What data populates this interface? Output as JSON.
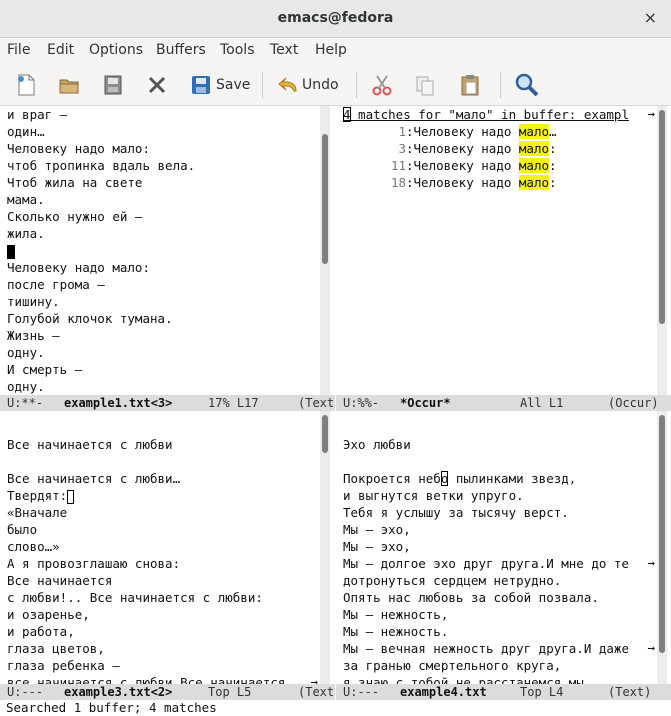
{
  "window": {
    "title": "emacs@fedora",
    "close_glyph": "×"
  },
  "menubar": [
    "File",
    "Edit",
    "Options",
    "Buffers",
    "Tools",
    "Text",
    "Help"
  ],
  "toolbar": {
    "save": "Save",
    "undo": "Undo"
  },
  "panes": {
    "top_left": {
      "lines": [
        "и враг —",
        "один…",
        "Человеку надо мало:",
        "чтоб тропинка вдаль вела.",
        "Чтоб жила на свете",
        "мама.",
        "Сколько нужно ей —",
        "жила.",
        "",
        "Человеку надо мало:",
        "после грома —",
        "тишину.",
        "Голубой клочок тумана.",
        "Жизнь —",
        "одну.",
        "И смерть —",
        "одну."
      ],
      "modeline": {
        "status": "U:**-",
        "buffer": "example1.txt<3>",
        "position": "17% L17",
        "mode": "(Text"
      }
    },
    "top_right": {
      "header_cursor": "4",
      "header_rest": " matches for \"мало\" in buffer: exampl",
      "matches": [
        {
          "num": "1",
          "pre": "Человеку надо ",
          "hit": "мало",
          "post": "…"
        },
        {
          "num": "3",
          "pre": "Человеку надо ",
          "hit": "мало",
          "post": ":"
        },
        {
          "num": "11",
          "pre": "Человеку надо ",
          "hit": "мало",
          "post": ":"
        },
        {
          "num": "18",
          "pre": "Человеку надо ",
          "hit": "мало",
          "post": ":"
        }
      ],
      "modeline": {
        "status": "U:%%-",
        "buffer": "*Occur*",
        "position": "All L1",
        "mode": "(Occur)"
      }
    },
    "bottom_left": {
      "lines_a": [
        "",
        "Все начинается с любви",
        "",
        "Все начинается с любви…"
      ],
      "tvердят": "Твердят:",
      "lines_b": [
        "«Вначале",
        "было",
        "слово…»",
        "А я провозглашаю снова:",
        "Все начинается",
        "с любви!.. Все начинается с любви:",
        "и озаренье,",
        "и работа,",
        "глаза цветов,",
        "глаза ребенка —",
        "все начинается с любви.Все начинается"
      ],
      "modeline": {
        "status": "U:---",
        "buffer": "example3.txt<2>",
        "position": "Top L5",
        "mode": "(Text"
      }
    },
    "bottom_right": {
      "line1": "",
      "line2": "Эхо любви",
      "line3": "",
      "line4_pre": "Покроется неб",
      "line4_cur": "о",
      "line4_post": " пылинками звезд,",
      "lines": [
        "и выгнутся ветки упруго.",
        "Тебя я услышу за тысячу верст.",
        "Мы — эхо,",
        "Мы — эхо,",
        "Мы — долгое эхо друг друга.И мне до те",
        "дотронуться сердцем нетрудно.",
        "Опять нас любовь за собой позвала.",
        "Мы — нежность,",
        "Мы — нежность.",
        "Мы — вечная нежность друг друга.И даже",
        "за гранью смертельного круга,",
        "я знаю с тобой не расстанемся мы."
      ],
      "modeline": {
        "status": "U:---",
        "buffer": "example4.txt",
        "position": "Top L4",
        "mode": "(Text)"
      }
    }
  },
  "minibuffer": "Searched 1 buffer; 4 matches",
  "colors": {
    "highlight": "#f5f21a",
    "modeline": "#dcdcdc",
    "toolbar": "#f6f5f4"
  }
}
